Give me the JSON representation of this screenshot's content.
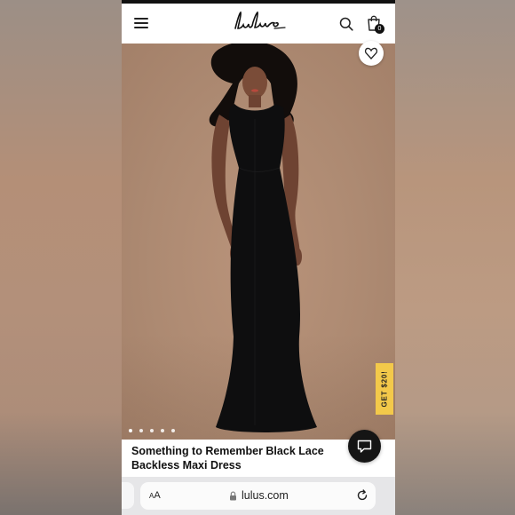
{
  "header": {
    "logo_text": "Lulus",
    "cart_count": "0",
    "icons": [
      "menu-icon",
      "search-icon",
      "shopping-bag-icon"
    ]
  },
  "product": {
    "title_line1": "Something to Remember Black Lace",
    "title_line2": "Backless Maxi Dress",
    "image_count": 5,
    "active_image": 1
  },
  "promo": {
    "label": "GET $20!"
  },
  "browser": {
    "text_size_label_small": "A",
    "text_size_label_large": "A",
    "url": "lulus.com"
  },
  "colors": {
    "promo_yellow": "#f3c94a",
    "backdrop_tan": "#b08f78",
    "dress_black": "#0e0e0f"
  }
}
